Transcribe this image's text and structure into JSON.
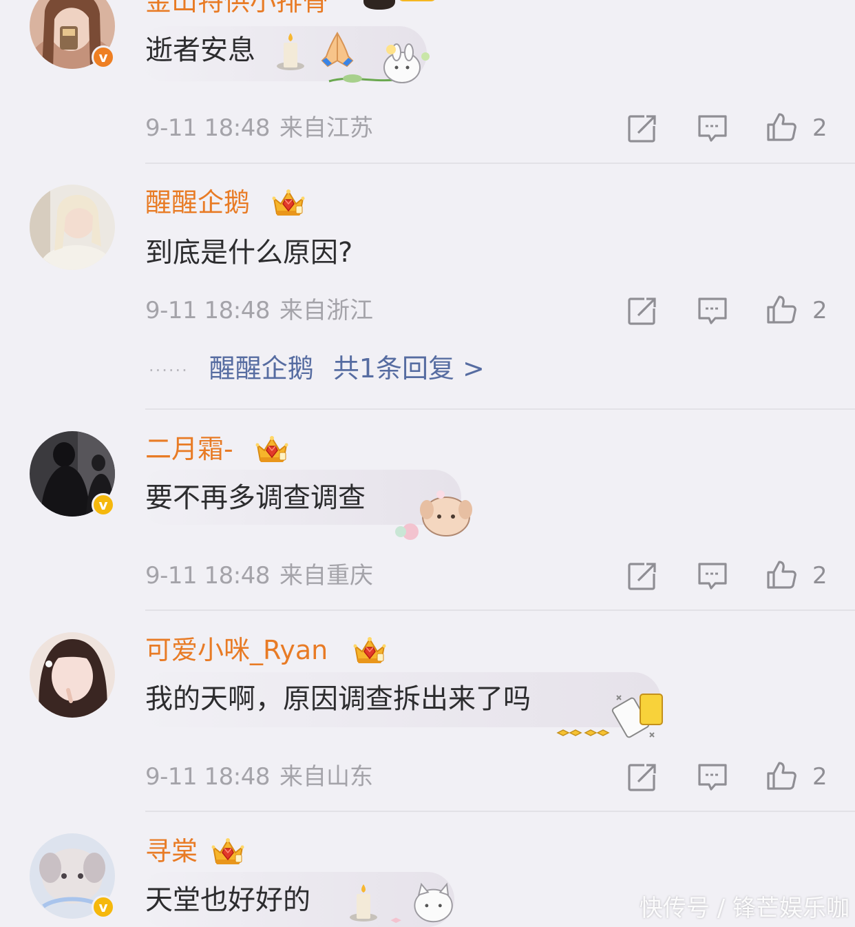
{
  "comments": [
    {
      "username": "金山特供小排骨",
      "content": "逝者安息",
      "time": "9-11 18:48",
      "location": "来自江苏",
      "likes": "2",
      "verified": "orange",
      "avatar_colors": [
        "#d9b39f",
        "#7a4b35"
      ]
    },
    {
      "username": "醒醒企鹅",
      "content": "到底是什么原因?",
      "time": "9-11 18:48",
      "location": "来自浙江",
      "likes": "2",
      "verified": "none",
      "avatar_colors": [
        "#e9e4dc",
        "#c9b9a5"
      ],
      "reply": {
        "dots": "······",
        "user": "醒醒企鹅",
        "text": "共1条回复 >"
      }
    },
    {
      "username": "二月霜-",
      "content": "要不再多调查调查",
      "time": "9-11 18:48",
      "location": "来自重庆",
      "likes": "2",
      "verified": "yellow",
      "avatar_colors": [
        "#3b3a3e",
        "#141316"
      ]
    },
    {
      "username": "可爱小咪_Ryan",
      "content": "我的天啊，原因调查拆出来了吗",
      "time": "9-11 18:48",
      "location": "来自山东",
      "likes": "2",
      "verified": "none",
      "avatar_colors": [
        "#efe3dd",
        "#3a2622"
      ]
    },
    {
      "username": "寻棠",
      "content": "天堂也好好的",
      "verified": "yellow",
      "avatar_colors": [
        "#dde3ee",
        "#a9b6cf"
      ]
    }
  ],
  "badge_text": "v",
  "watermark": "快传号 / 锋芒娱乐咖",
  "icons": [
    "share-icon",
    "comment-icon",
    "like-icon",
    "crown-badge-icon",
    "verified-icon"
  ],
  "colors": {
    "username": "#e87b25",
    "reply_link": "#566ca1",
    "meta": "#a4a3a9",
    "background": "#f1f0f5"
  }
}
